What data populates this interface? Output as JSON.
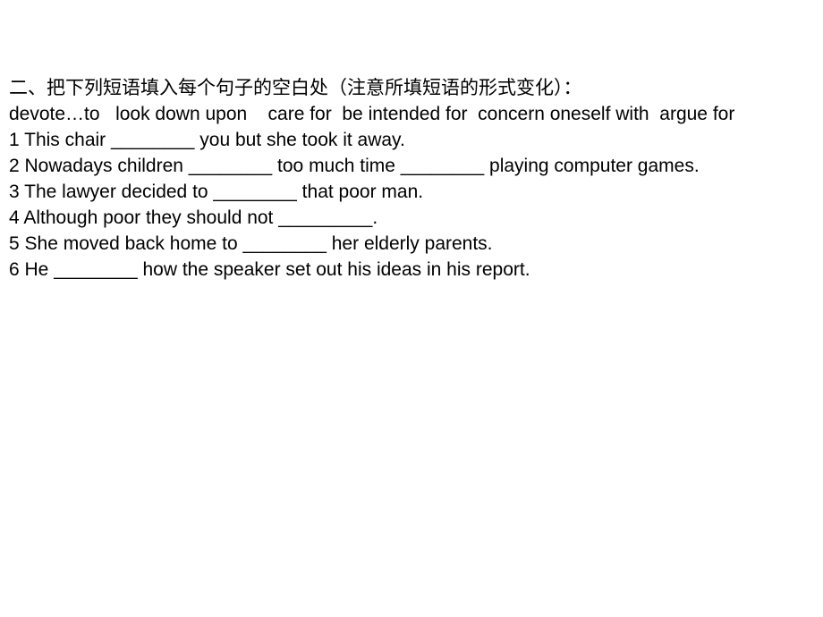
{
  "slide": {
    "background_color": "#ffffff",
    "text_color": "#000000",
    "heading": "二、把下列短语填入每个句子的空白处（注意所填短语的形式变化）：",
    "phrase_bank": "devote…to   look down upon    care for  be intended for  concern oneself with  argue for",
    "phrases": [
      "devote…to",
      "look down upon",
      "care for",
      "be intended for",
      "concern oneself with",
      "argue for"
    ],
    "blank_token": "________",
    "questions": [
      {
        "number": "1",
        "text": "1 This chair ________ you but she took it away.",
        "parts": [
          "1 This chair ",
          "________",
          " you but she took it away."
        ]
      },
      {
        "number": "2",
        "text": "2 Nowadays children ________ too much time ________ playing computer games.",
        "parts": [
          "2 Nowadays children ",
          "________",
          " too much time ",
          "________",
          " playing computer games."
        ]
      },
      {
        "number": "3",
        "text": "3 The lawyer decided to ________ that poor man.",
        "parts": [
          "3 The lawyer decided to ",
          "________",
          " that poor man."
        ]
      },
      {
        "number": "4",
        "text": "4 Although poor they should not _________.",
        "parts": [
          "4 Although poor they should not ",
          "_________",
          "."
        ]
      },
      {
        "number": "5",
        "text": "5 She moved back home to ________ her elderly parents.",
        "parts": [
          "5 She moved back home to ",
          "________",
          " her elderly parents."
        ]
      },
      {
        "number": "6",
        "text": "6 He ________ how the speaker set out his ideas in his report.",
        "parts": [
          "6 He ",
          "________",
          " how the speaker set out his ideas in his report."
        ]
      }
    ]
  }
}
